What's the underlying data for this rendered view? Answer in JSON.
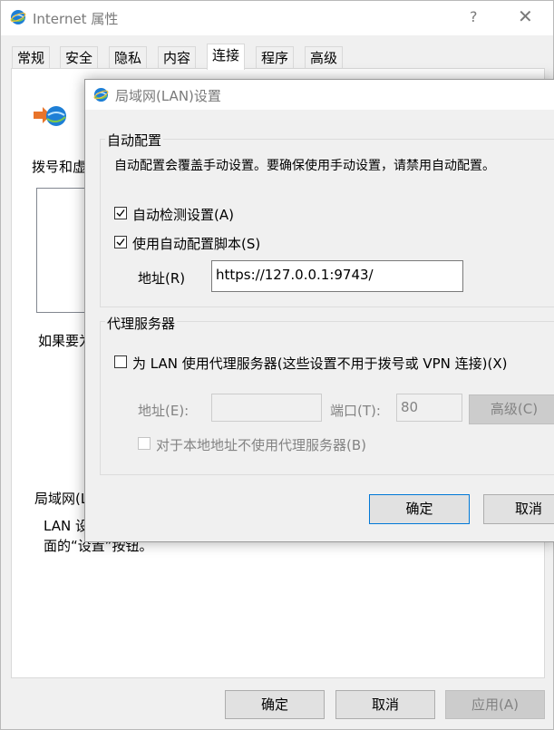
{
  "outer_window": {
    "title": "Internet 属性",
    "help_glyph": "?",
    "close_glyph": "✕",
    "tabs": [
      "常规",
      "安全",
      "隐私",
      "内容",
      "连接",
      "程序",
      "高级"
    ],
    "active_tab": "连接",
    "dialup_label": "拨号和虚",
    "proxy_hint": "如果要为",
    "lan_section_label": "局域网(L",
    "lan_desc_line1": "LAN 设",
    "lan_desc_line2": "面的“设置”按钮。",
    "buttons": {
      "ok": "确定",
      "cancel": "取消",
      "apply": "应用(A)"
    }
  },
  "lan_dialog": {
    "title": "局域网(LAN)设置",
    "auto_config": {
      "legend": "自动配置",
      "description": "自动配置会覆盖手动设置。要确保使用手动设置，请禁用自动配置。",
      "auto_detect_label": "自动检测设置(A)",
      "auto_detect_checked": true,
      "use_script_label": "使用自动配置脚本(S)",
      "use_script_checked": true,
      "address_label": "地址(R)",
      "address_value": "https://127.0.0.1:9743/"
    },
    "proxy": {
      "legend": "代理服务器",
      "use_proxy_label": "为 LAN 使用代理服务器(这些设置不用于拨号或 VPN 连接)(X)",
      "use_proxy_checked": false,
      "address_label": "地址(E):",
      "address_value": "",
      "port_label": "端口(T):",
      "port_value": "80",
      "advanced_label": "高级(C)",
      "bypass_local_label": "对于本地地址不使用代理服务器(B)",
      "bypass_local_checked": false
    },
    "buttons": {
      "ok": "确定",
      "cancel": "取消"
    }
  },
  "colors": {
    "ie_icon_blue": "#1e7fd6",
    "arrow_orange": "#e8742a",
    "focus_border": "#0078d7",
    "disabled_text": "#838383"
  },
  "icons": [
    "ie-globe-icon",
    "close-icon",
    "help-icon",
    "connection-setup-icon",
    "checkmark-icon"
  ]
}
